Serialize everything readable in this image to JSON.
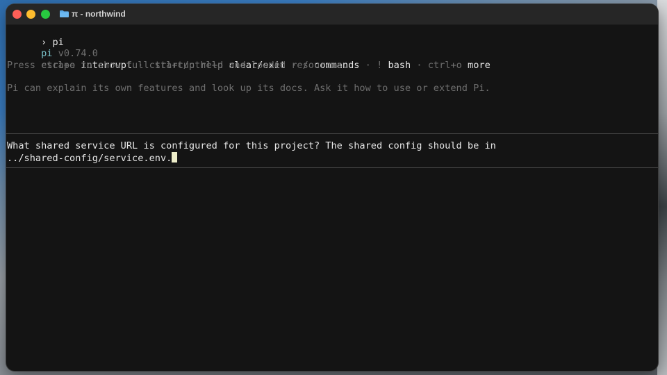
{
  "window": {
    "title": "π - northwind",
    "folder_icon": "folder-icon",
    "controls": [
      "close-button",
      "minimize-button",
      "zoom-button"
    ]
  },
  "terminal": {
    "prompt_symbol": "›",
    "command": "pi",
    "app_name": "pi",
    "version": "v0.74.0",
    "shortcuts": [
      {
        "key": "escape",
        "action": "interrupt"
      },
      {
        "key": "ctrl+c/ctrl+d",
        "action": "clear/exit"
      },
      {
        "key": "/",
        "action": "commands"
      },
      {
        "key": "!",
        "action": "bash"
      },
      {
        "key": "ctrl+o",
        "action": "more"
      }
    ],
    "separator": " · ",
    "help_hint": "Press ctrl+o to show full startup help and loaded resources.",
    "info": "Pi can explain its own features and look up its docs. Ask it how to use or extend Pi.",
    "input_line_1": "What shared service URL is configured for this project? The shared config should be in",
    "input_line_2": "../shared-config/service.env."
  },
  "colors": {
    "background": "#141414",
    "dim_text": "#6e6e6e",
    "bright_text": "#e6e6e6",
    "accent": "#79c1c9",
    "cursor": "#ededc9"
  }
}
